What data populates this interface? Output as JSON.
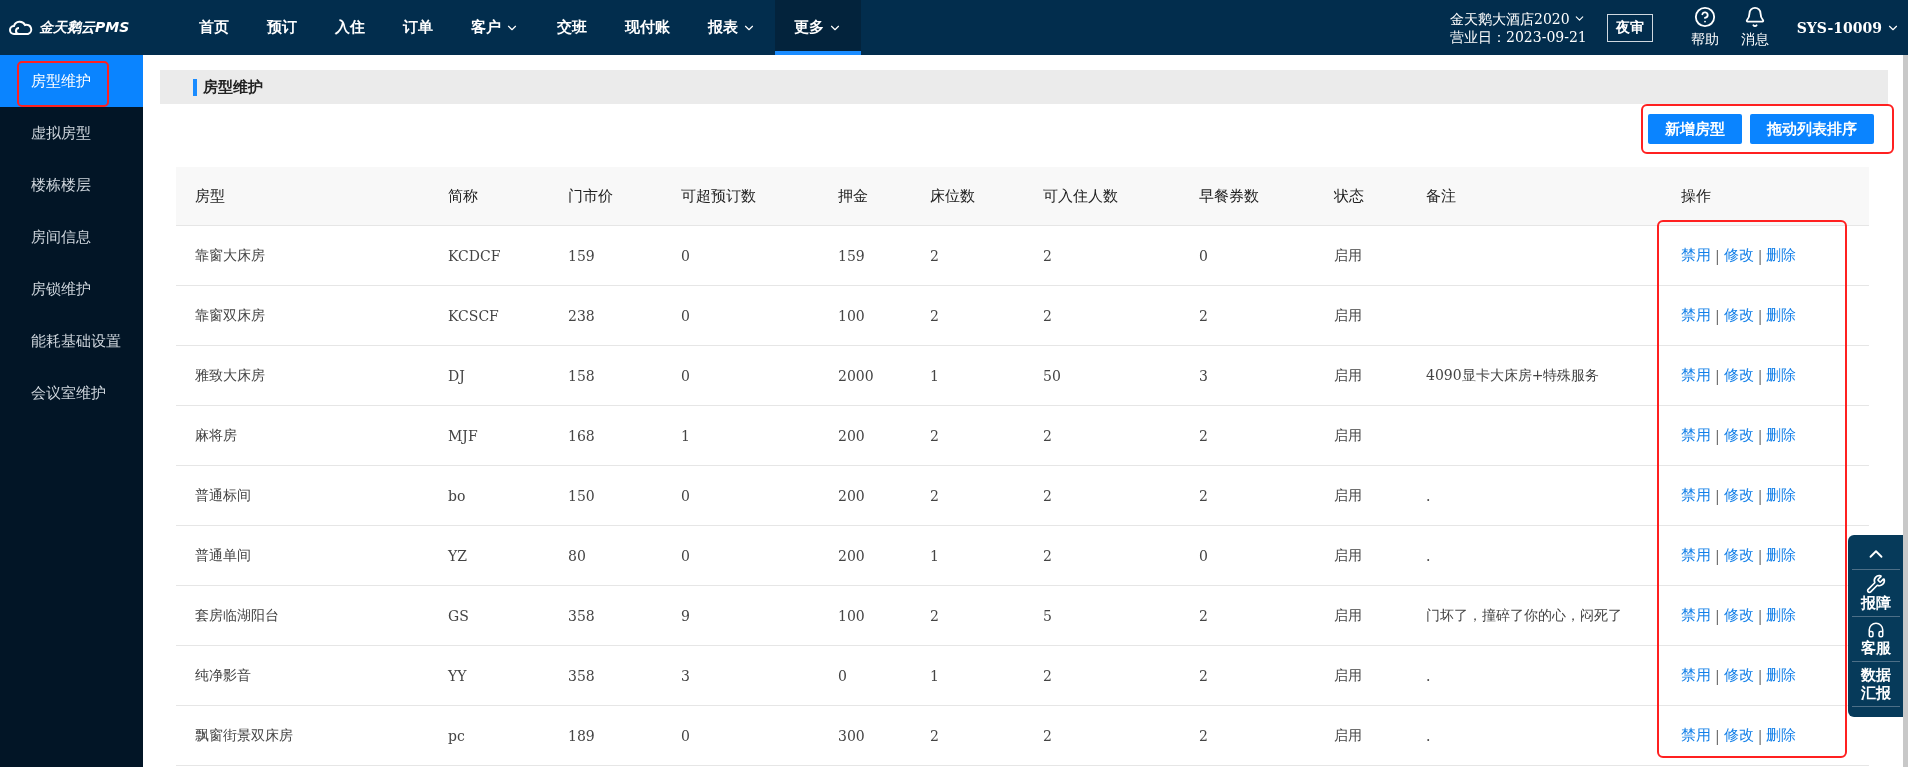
{
  "logo": {
    "text": "金天鹅云PMS"
  },
  "nav": [
    {
      "label": "首页",
      "dropdown": false,
      "selected": false
    },
    {
      "label": "预订",
      "dropdown": false,
      "selected": false
    },
    {
      "label": "入住",
      "dropdown": false,
      "selected": false
    },
    {
      "label": "订单",
      "dropdown": false,
      "selected": false
    },
    {
      "label": "客户",
      "dropdown": true,
      "selected": false
    },
    {
      "label": "交班",
      "dropdown": false,
      "selected": false
    },
    {
      "label": "现付账",
      "dropdown": false,
      "selected": false
    },
    {
      "label": "报表",
      "dropdown": true,
      "selected": false
    },
    {
      "label": "更多",
      "dropdown": true,
      "selected": true
    }
  ],
  "hotel": {
    "name": "金天鹅大酒店2020",
    "business_date": "营业日：2023-09-21"
  },
  "night_audit": "夜审",
  "help": "帮助",
  "messages": "消息",
  "user": "SYS-10009",
  "sidebar": {
    "items": [
      {
        "label": "房型维护",
        "selected": true,
        "highlighted": true
      },
      {
        "label": "虚拟房型",
        "selected": false,
        "highlighted": false
      },
      {
        "label": "楼栋楼层",
        "selected": false,
        "highlighted": false
      },
      {
        "label": "房间信息",
        "selected": false,
        "highlighted": false
      },
      {
        "label": "房锁维护",
        "selected": false,
        "highlighted": false
      },
      {
        "label": "能耗基础设置",
        "selected": false,
        "highlighted": false
      },
      {
        "label": "会议室维护",
        "selected": false,
        "highlighted": false
      }
    ]
  },
  "panel_title": "房型维护",
  "toolbar": {
    "highlighted": true,
    "buttons": [
      "新增房型",
      "拖动列表排序"
    ]
  },
  "table": {
    "columns": [
      "房型",
      "简称",
      "门市价",
      "可超预订数",
      "押金",
      "床位数",
      "可入住人数",
      "早餐券数",
      "状态",
      "备注",
      "操作"
    ],
    "actions_highlighted": true,
    "separator": "|",
    "rows": [
      {
        "cells": [
          "靠窗大床房",
          "KCDCF",
          "159",
          "0",
          "159",
          "2",
          "2",
          "0",
          "启用"
        ],
        "actions": [
          "禁用",
          "修改",
          "删除"
        ]
      },
      {
        "cells": [
          "靠窗双床房",
          "KCSCF",
          "238",
          "0",
          "100",
          "2",
          "2",
          "2",
          "启用"
        ],
        "actions": [
          "禁用",
          "修改",
          "删除"
        ]
      },
      {
        "cells": [
          "雅致大床房",
          "DJ",
          "158",
          "0",
          "2000",
          "1",
          "50",
          "3",
          "启用"
        ],
        "note": "4090显卡大床房+特殊服务",
        "actions": [
          "禁用",
          "修改",
          "删除"
        ]
      },
      {
        "cells": [
          "麻将房",
          "MJF",
          "168",
          "1",
          "200",
          "2",
          "2",
          "2",
          "启用"
        ],
        "actions": [
          "禁用",
          "修改",
          "删除"
        ]
      },
      {
        "cells": [
          "普通标间",
          "bo",
          "150",
          "0",
          "200",
          "2",
          "2",
          "2",
          "启用"
        ],
        "note": ".",
        "actions": [
          "禁用",
          "修改",
          "删除"
        ]
      },
      {
        "cells": [
          "普通单间",
          "YZ",
          "80",
          "0",
          "200",
          "1",
          "2",
          "0",
          "启用"
        ],
        "note": ".",
        "actions": [
          "禁用",
          "修改",
          "删除"
        ]
      },
      {
        "cells": [
          "套房临湖阳台",
          "GS",
          "358",
          "9",
          "100",
          "2",
          "5",
          "2",
          "启用"
        ],
        "note": "门坏了，撞碎了你的心，闷死了",
        "actions": [
          "禁用",
          "修改",
          "删除"
        ]
      },
      {
        "cells": [
          "纯净影音",
          "YY",
          "358",
          "3",
          "0",
          "1",
          "2",
          "2",
          "启用"
        ],
        "note": ".",
        "actions": [
          "禁用",
          "修改",
          "删除"
        ]
      },
      {
        "cells": [
          "飘窗街景双床房",
          "pc",
          "189",
          "0",
          "300",
          "2",
          "2",
          "2",
          "启用"
        ],
        "note": ".",
        "actions": [
          "禁用",
          "修改",
          "删除"
        ]
      }
    ]
  },
  "side_tools": [
    {
      "kind": "up"
    },
    {
      "kind": "wrench",
      "label": "报障"
    },
    {
      "kind": "headset",
      "label": "客服"
    },
    {
      "kind": "text",
      "label": "数据汇报"
    }
  ]
}
